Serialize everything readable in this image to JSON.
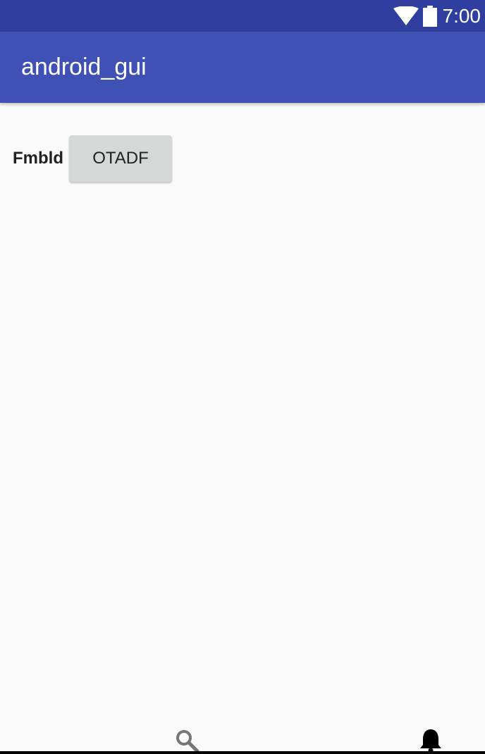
{
  "status_bar": {
    "time": "7:00",
    "icons": [
      "wifi-icon",
      "battery-icon"
    ]
  },
  "app_bar": {
    "title": "android_gui"
  },
  "main": {
    "label": "Fmbld",
    "button_label": "OTADF"
  },
  "bottom_bar": {
    "icons": [
      "search-icon",
      "bell-icon"
    ]
  },
  "colors": {
    "status_bar": "#303f9f",
    "app_bar": "#3f51b5",
    "background": "#fafafa",
    "button": "#d6d7d7"
  }
}
